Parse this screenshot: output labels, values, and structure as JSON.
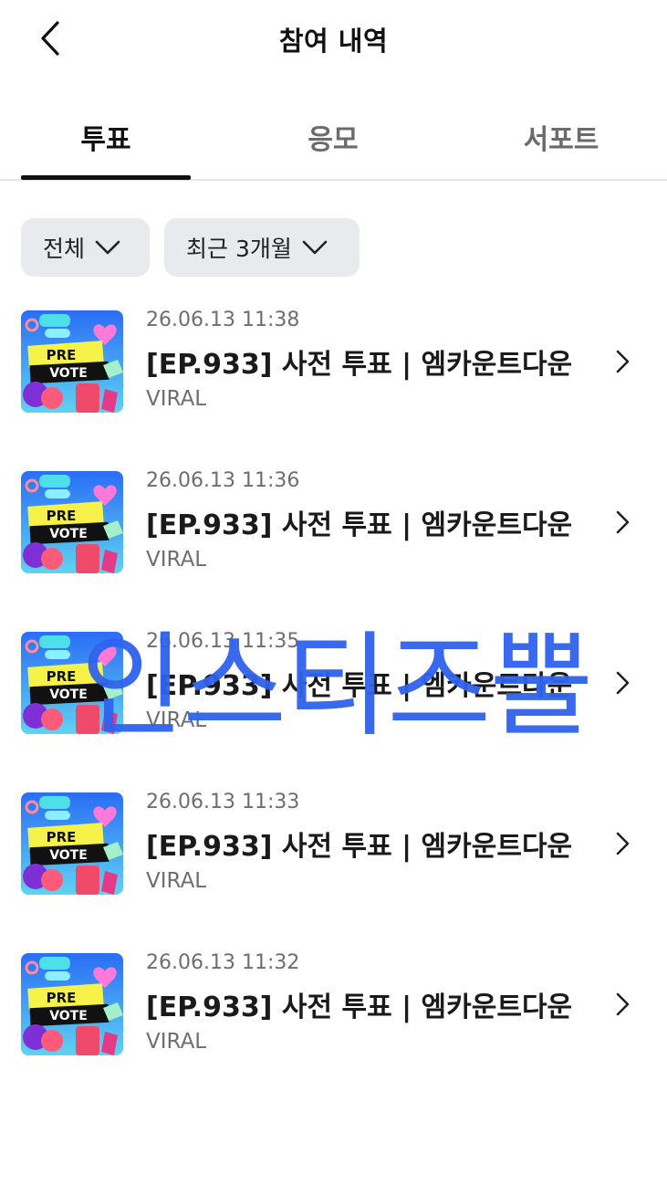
{
  "header": {
    "title": "참여 내역",
    "back_icon": "chevron-left-icon"
  },
  "tabs": [
    {
      "label": "투표",
      "active": true
    },
    {
      "label": "응모",
      "active": false
    },
    {
      "label": "서포트",
      "active": false
    }
  ],
  "filters": [
    {
      "label": "전체",
      "icon": "chevron-down-icon"
    },
    {
      "label": "최근 3개월",
      "icon": "chevron-down-icon"
    }
  ],
  "items": [
    {
      "date": "26.06.13 11:38",
      "title": "[EP.933] 사전 투표 | 엠카운트다운",
      "subtitle": "VIRAL",
      "thumb_text_1": "PRE",
      "thumb_text_2": "VOTE"
    },
    {
      "date": "26.06.13 11:36",
      "title": "[EP.933] 사전 투표 | 엠카운트다운",
      "subtitle": "VIRAL",
      "thumb_text_1": "PRE",
      "thumb_text_2": "VOTE"
    },
    {
      "date": "26.06.13 11:35",
      "title": "[EP.933] 사전 투표 | 엠카운트다운",
      "subtitle": "VIRAL",
      "thumb_text_1": "PRE",
      "thumb_text_2": "VOTE"
    },
    {
      "date": "26.06.13 11:33",
      "title": "[EP.933] 사전 투표 | 엠카운트다운",
      "subtitle": "VIRAL",
      "thumb_text_1": "PRE",
      "thumb_text_2": "VOTE"
    },
    {
      "date": "26.06.13 11:32",
      "title": "[EP.933] 사전 투표 | 엠카운트다운",
      "subtitle": "VIRAL",
      "thumb_text_1": "PRE",
      "thumb_text_2": "VOTE"
    }
  ],
  "watermark": "인스티즈뿔",
  "colors": {
    "watermark": "#2f63ee",
    "chip_bg": "#e9eaee",
    "active_tab": "#111111"
  }
}
